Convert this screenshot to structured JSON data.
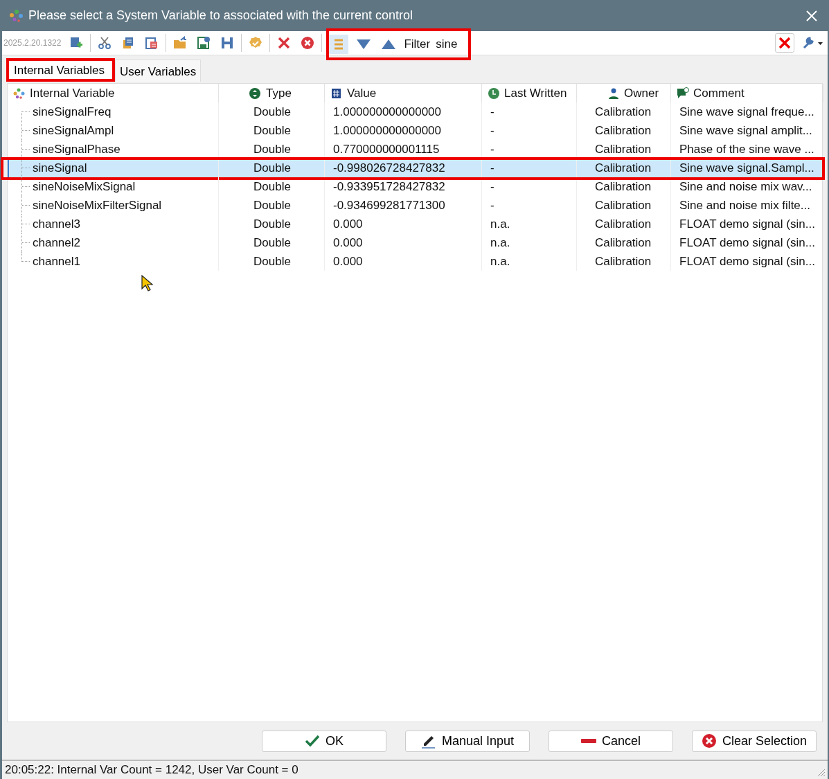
{
  "window": {
    "title": "Please select a System Variable to associated with the current control"
  },
  "toolbar": {
    "version": "2025.2.20.1322",
    "tools": [
      {
        "kind": "add"
      },
      {
        "kind": "separator"
      },
      {
        "kind": "cut"
      },
      {
        "kind": "copy"
      },
      {
        "kind": "paste"
      },
      {
        "kind": "separator"
      },
      {
        "kind": "open"
      },
      {
        "kind": "save"
      },
      {
        "kind": "h"
      },
      {
        "kind": "separator"
      },
      {
        "kind": "badge"
      },
      {
        "kind": "separator"
      },
      {
        "kind": "delete"
      },
      {
        "kind": "delete-circle"
      },
      {
        "kind": "separator"
      }
    ],
    "filter_group": {
      "highlighted": true,
      "label": "Filter",
      "value": "sine"
    }
  },
  "tabs": [
    {
      "label": "Internal Variables",
      "selected": true,
      "highlighted": true
    },
    {
      "label": "User Variables",
      "selected": false,
      "highlighted": false
    }
  ],
  "table": {
    "columns": [
      {
        "label": "Internal Variable"
      },
      {
        "label": "Type"
      },
      {
        "label": "Value"
      },
      {
        "label": "Last Written"
      },
      {
        "label": "Owner"
      },
      {
        "label": "Comment"
      }
    ],
    "rows": [
      {
        "name": "sineSignalFreq",
        "type": "Double",
        "value": "1.000000000000000",
        "last_written": "-",
        "owner": "Calibration",
        "comment": "Sine wave signal freque...",
        "selected": false,
        "highlighted": false
      },
      {
        "name": "sineSignalAmpl",
        "type": "Double",
        "value": "1.000000000000000",
        "last_written": "-",
        "owner": "Calibration",
        "comment": "Sine wave signal amplit...",
        "selected": false,
        "highlighted": false
      },
      {
        "name": "sineSignalPhase",
        "type": "Double",
        "value": "0.770000000001115",
        "last_written": "-",
        "owner": "Calibration",
        "comment": "Phase of the sine wave ...",
        "selected": false,
        "highlighted": false
      },
      {
        "name": "sineSignal",
        "type": "Double",
        "value": "-0.998026728427832",
        "last_written": "-",
        "owner": "Calibration",
        "comment": "Sine wave signal.Sampl...",
        "selected": true,
        "highlighted": true
      },
      {
        "name": "sineNoiseMixSignal",
        "type": "Double",
        "value": "-0.933951728427832",
        "last_written": "-",
        "owner": "Calibration",
        "comment": "Sine and noise mix wav...",
        "selected": false,
        "highlighted": false
      },
      {
        "name": "sineNoiseMixFilterSignal",
        "type": "Double",
        "value": "-0.934699281771300",
        "last_written": "-",
        "owner": "Calibration",
        "comment": "Sine and noise mix filte...",
        "selected": false,
        "highlighted": false
      },
      {
        "name": "channel3",
        "type": "Double",
        "value": "0.000",
        "last_written": "n.a.",
        "owner": "Calibration",
        "comment": "FLOAT demo signal (sin...",
        "selected": false,
        "highlighted": false
      },
      {
        "name": "channel2",
        "type": "Double",
        "value": "0.000",
        "last_written": "n.a.",
        "owner": "Calibration",
        "comment": "FLOAT demo signal (sin...",
        "selected": false,
        "highlighted": false
      },
      {
        "name": "channel1",
        "type": "Double",
        "value": "0.000",
        "last_written": "n.a.",
        "owner": "Calibration",
        "comment": "FLOAT demo signal (sin...",
        "selected": false,
        "highlighted": false
      }
    ]
  },
  "buttons": [
    {
      "label": "OK",
      "kind": "ok"
    },
    {
      "label": "Manual Input",
      "kind": "edit"
    },
    {
      "label": "Cancel",
      "kind": "cancel"
    },
    {
      "label": "Clear Selection",
      "kind": "clear"
    }
  ],
  "status_bar": "20:05:22: Internal Var Count = 1242, User Var Count = 0"
}
